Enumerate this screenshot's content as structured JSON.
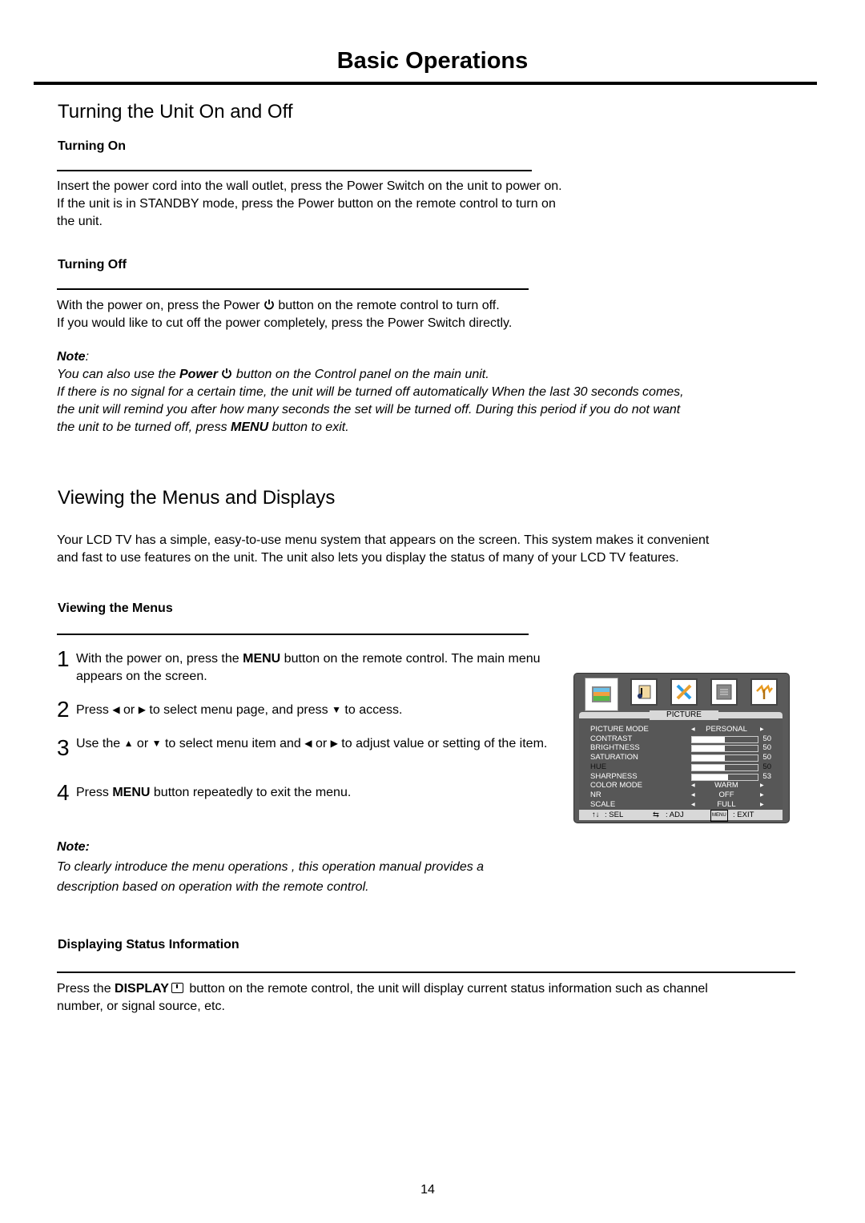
{
  "page": {
    "title": "Basic Operations",
    "page_number": "14"
  },
  "section1": {
    "heading": "Turning the Unit On and Off",
    "turning_on": {
      "heading": "Turning On",
      "lines": [
        "Insert the power cord into the wall outlet, press the Power Switch on the unit to power on.",
        "If the unit is in STANDBY mode, press the Power button on the remote control to turn on",
        "the unit."
      ]
    },
    "turning_off": {
      "heading": "Turning Off",
      "line1_a": "With the power on, press the Power",
      "line1_b": "button on the remote control to turn off.",
      "line2": "If you would like to cut off the power completely, press the Power Switch directly."
    },
    "note": {
      "label": "Note",
      "colon": ":",
      "line1_a": "You can also use the ",
      "line1_bold": "Power",
      "line1_b": "button on the Control panel on the main unit.",
      "line2": "If there is no signal for a certain time, the unit will be turned off automatically When the last 30 seconds comes,",
      "line3": "the unit will remind you after how many seconds the set will be turned off. During this period if you do not want",
      "line4_a": "the unit to be turned off, press ",
      "line4_bold": "MENU",
      "line4_b": " button to exit."
    }
  },
  "section2": {
    "heading": "Viewing the Menus and Displays",
    "intro": [
      "Your LCD TV has a simple, easy-to-use menu system that appears on the screen. This system makes it convenient",
      "and fast to use features on the unit. The unit also lets you display the status of many of your LCD TV features."
    ],
    "viewing_menus": {
      "heading": "Viewing the Menus",
      "steps": [
        {
          "num": "1",
          "a": "With the power on, press the ",
          "bold": "MENU",
          "b": " button on the remote control. The main menu appears on the screen."
        },
        {
          "num": "2",
          "a": "Press ",
          "left": "◀",
          "or1": " or ",
          "right": "▶",
          "b": " to select menu page, and press ",
          "down": "▼",
          "c": " to access."
        },
        {
          "num": "3",
          "a": "Use the ",
          "up": "▲",
          "or1": " or ",
          "down": "▼",
          "b": " to select menu item and ",
          "left": "◀",
          "or2": " or ",
          "right": "▶",
          "c": " to adjust value or setting of the item."
        },
        {
          "num": "4",
          "a": "Press ",
          "bold": "MENU",
          "b": " button repeatedly to exit the menu."
        }
      ]
    },
    "note": {
      "label": "Note:",
      "lines": [
        "To clearly introduce the menu operations , this operation manual provides a",
        "description based on operation with the remote control."
      ]
    },
    "status": {
      "heading": "Displaying Status Information",
      "line1_a": "Press the ",
      "line1_bold": "DISPLAY",
      "line1_b": " button on the remote control, the unit will display current status information such as channel",
      "line2": "number, or signal source, etc."
    }
  },
  "tv_menu": {
    "icons": [
      "picture-icon",
      "sound-icon",
      "setup-icon",
      "menu-settings-icon",
      "channel-antenna-icon"
    ],
    "tab": "PICTURE",
    "rows": [
      {
        "label": "PICTURE MODE",
        "type": "option",
        "value": "PERSONAL"
      },
      {
        "label": "CONTRAST",
        "type": "bar",
        "value": "50",
        "fraction": 0.5
      },
      {
        "label": "BRIGHTNESS",
        "type": "bar",
        "value": "50",
        "fraction": 0.5
      },
      {
        "label": "SATURATION",
        "type": "bar",
        "value": "50",
        "fraction": 0.5
      },
      {
        "label": "HUE",
        "type": "bar",
        "value": "50",
        "fraction": 0.5,
        "highlighted": true
      },
      {
        "label": "SHARPNESS",
        "type": "bar",
        "value": "53",
        "fraction": 0.55
      },
      {
        "label": "COLOR MODE",
        "type": "option",
        "value": "WARM"
      },
      {
        "label": "NR",
        "type": "option",
        "value": "OFF"
      },
      {
        "label": "SCALE",
        "type": "option",
        "value": "FULL"
      }
    ],
    "footer": {
      "sel_arrows": "↑↓",
      "sel": ": SEL",
      "adj_arrows": "⇆",
      "adj": ": ADJ",
      "menu_key": "MENU",
      "exit": ": EXIT"
    }
  }
}
